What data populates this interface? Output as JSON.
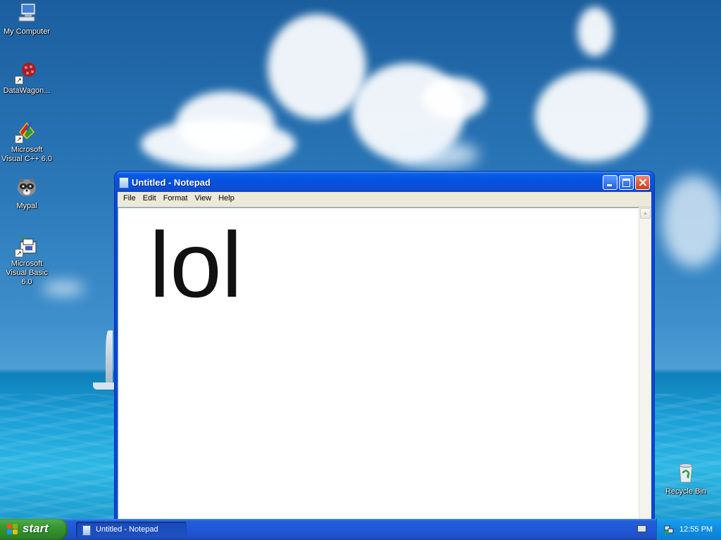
{
  "desktop": {
    "icons": [
      {
        "label": "My Computer",
        "icon": "my-computer-icon"
      },
      {
        "label": "DataWagon...",
        "icon": "datawagon-icon"
      },
      {
        "label": "Microsoft Visual C++ 6.0",
        "icon": "visual-cpp-icon"
      },
      {
        "label": "Mypal",
        "icon": "mypal-raccoon-icon"
      },
      {
        "label": "Microsoft Visual Basic 6.0",
        "icon": "visual-basic-icon"
      },
      {
        "label": "Recycle Bin",
        "icon": "recycle-bin-icon"
      }
    ]
  },
  "window": {
    "title": "Untitled - Notepad",
    "menu": [
      "File",
      "Edit",
      "Format",
      "View",
      "Help"
    ],
    "content": "lol"
  },
  "taskbar": {
    "start_label": "start",
    "task_label": "Untitled - Notepad",
    "clock": "12:55 PM",
    "colors": {
      "taskbar_blue": "#245edb",
      "start_green": "#3c9b34",
      "tray_blue": "#0f8de0",
      "close_red": "#d23a17"
    }
  }
}
